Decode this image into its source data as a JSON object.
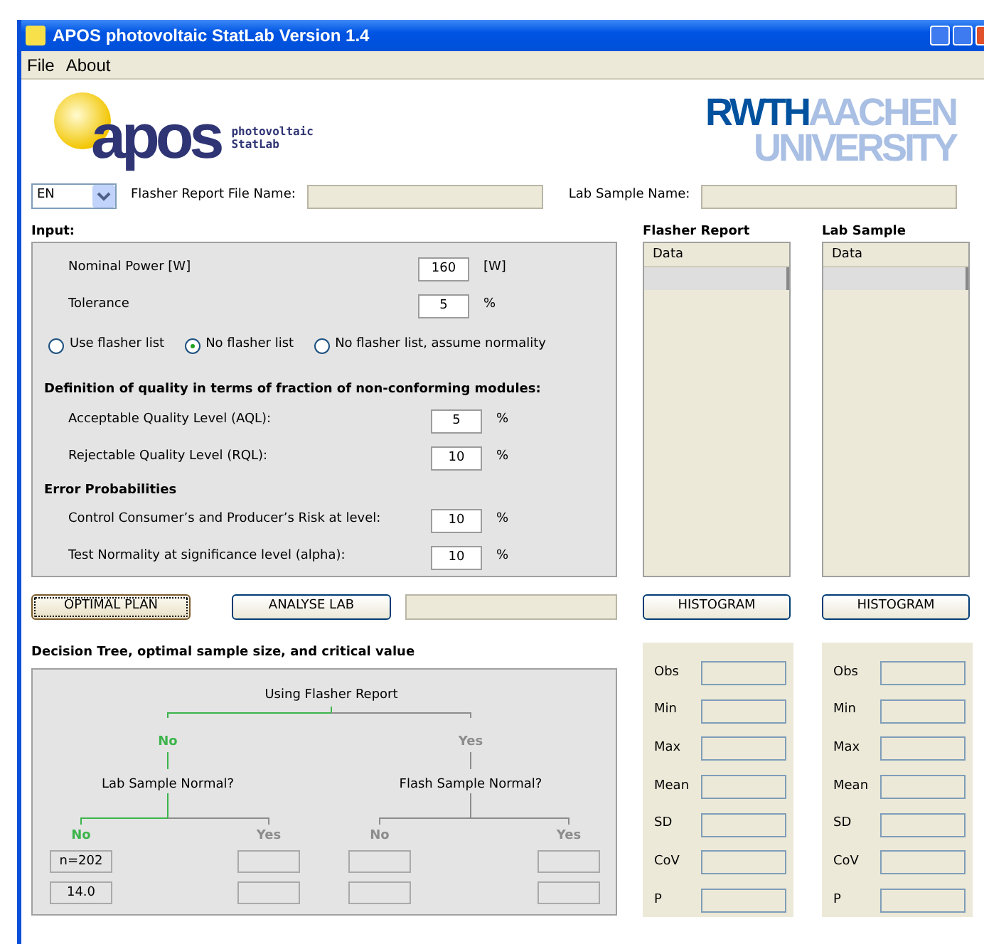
{
  "window": {
    "title": "APOS photovoltaic StatLab Version 1.4"
  },
  "menu": [
    "File",
    "About"
  ],
  "logo": {
    "wordmark": "apos",
    "tagline": [
      "photovoltaic",
      "StatLab"
    ]
  },
  "university_logo": {
    "lines": [
      "RWTH",
      "AACHEN",
      "UNIVERSITY"
    ]
  },
  "language_select": {
    "value": "EN"
  },
  "file_fields": [
    {
      "label": "Flasher Report File Name:"
    },
    {
      "label": "Lab Sample Name:"
    }
  ],
  "input": {
    "title": "Input:",
    "fields": [
      {
        "label": "Nominal Power [W]",
        "value": "160",
        "unit": "[W]"
      },
      {
        "label": "Tolerance",
        "value": "5",
        "unit": "%"
      }
    ],
    "modes": [
      {
        "label": "Use flasher list",
        "selected": false
      },
      {
        "label": "No flasher list",
        "selected": true
      },
      {
        "label": "No flasher list, assume normality",
        "selected": false
      }
    ],
    "quality": {
      "title": "Definition of quality in terms of fraction of non-conforming modules:",
      "fields": [
        {
          "label": "Acceptable Quality Level (AQL):",
          "value": "5",
          "unit": "%"
        },
        {
          "label": "Rejectable Quality Level (RQL):",
          "value": "10",
          "unit": "%"
        }
      ]
    },
    "errors": {
      "title": "Error Probabilities",
      "fields": [
        {
          "label": "Control Consumer’s and Producer’s Risk at level:",
          "value": "10",
          "unit": "%"
        },
        {
          "label": "Test Normality at significance level (alpha):",
          "value": "10",
          "unit": "%"
        }
      ]
    }
  },
  "actions": [
    {
      "label": "OPTIMAL PLAN",
      "focused": true
    },
    {
      "label": "ANALYSE LAB",
      "focused": false
    }
  ],
  "data_lists": [
    {
      "title": "Flasher Report",
      "column": "Data",
      "button": "HISTOGRAM",
      "stats": [
        "Obs",
        "Min",
        "Max",
        "Mean",
        "SD",
        "CoV",
        "P"
      ]
    },
    {
      "title": "Lab Sample",
      "column": "Data",
      "button": "HISTOGRAM",
      "stats": [
        "Obs",
        "Min",
        "Max",
        "Mean",
        "SD",
        "CoV",
        "P"
      ]
    }
  ],
  "tree": {
    "title": "Decision Tree, optimal sample size, and critical value",
    "question": "Using Flasher Report",
    "branches": [
      {
        "label": "No",
        "active": true,
        "question": "Lab Sample Normal?",
        "branches": [
          {
            "label": "No",
            "active": true,
            "results": [
              "n=202",
              "14.0"
            ]
          },
          {
            "label": "Yes",
            "active": false
          }
        ]
      },
      {
        "label": "Yes",
        "active": false,
        "question": "Flash Sample Normal?",
        "branches": [
          {
            "label": "No",
            "active": false
          },
          {
            "label": "Yes",
            "active": false
          }
        ]
      }
    ]
  }
}
